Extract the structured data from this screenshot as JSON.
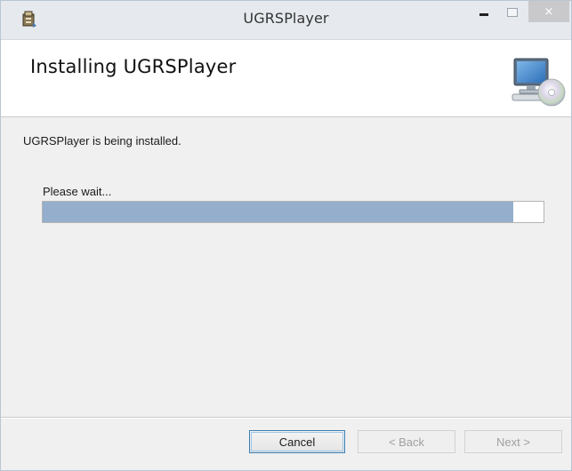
{
  "window": {
    "title": "UGRSPlayer",
    "close_glyph": "×",
    "icons": {
      "app": "installer-package-icon",
      "minimize": "minimize-icon",
      "maximize": "maximize-icon",
      "close": "close-icon",
      "banner": "computer-cd-icon"
    }
  },
  "banner": {
    "title": "Installing UGRSPlayer"
  },
  "content": {
    "status": "UGRSPlayer is being installed.",
    "wait_label": "Please wait...",
    "progress_fraction": 0.94
  },
  "buttons": {
    "cancel": "Cancel",
    "back": "< Back",
    "next": "Next >"
  },
  "colors": {
    "progress_fill": "#95aecb",
    "focus_border": "#3c7fb1"
  }
}
